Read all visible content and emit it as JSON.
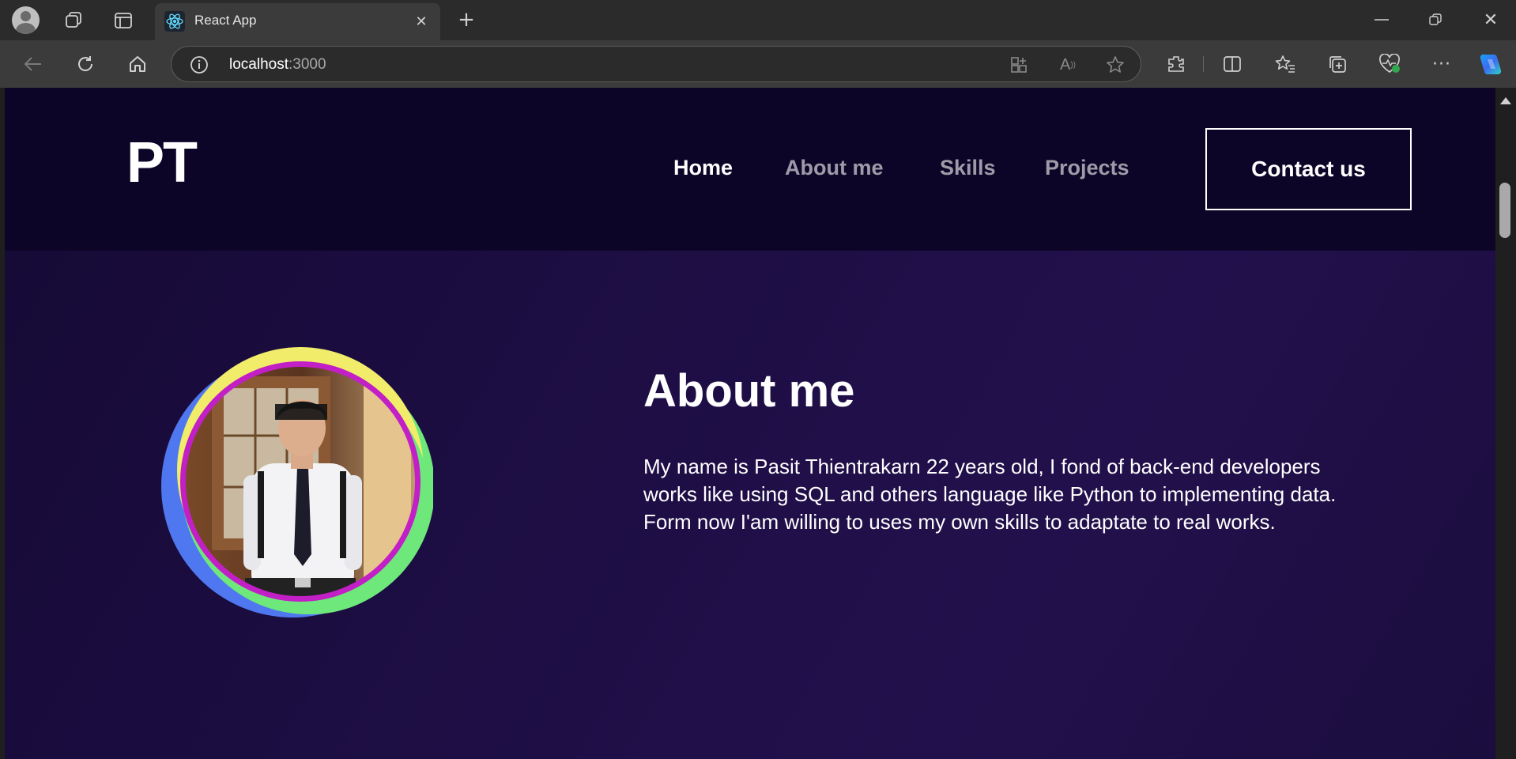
{
  "browser": {
    "tab_title": "React App",
    "address_host": "localhost",
    "address_port": ":3000"
  },
  "site": {
    "logo": "PT",
    "nav": [
      {
        "label": "Home",
        "active": true
      },
      {
        "label": "About me",
        "active": false
      },
      {
        "label": "Skills",
        "active": false
      },
      {
        "label": "Projects",
        "active": false
      }
    ],
    "contact_label": "Contact us"
  },
  "about": {
    "heading": "About me",
    "bio": "My name is Pasit Thientrakarn 22 years old, I fond of back-end developers works like using SQL and others language like Python to implementing data. Form now I'am willing to uses my own skills to adaptate to real works."
  },
  "colors": {
    "nav_bg": "#0d0527",
    "page_bg": "#1e0e45",
    "ring_yellow": "#f1ed6a",
    "ring_blue": "#4f78f0",
    "ring_green": "#6ee87a",
    "ring_magenta": "#c21fc6"
  },
  "icons": [
    "profile-icon",
    "workspaces-icon",
    "tab-actions-icon",
    "react-icon",
    "close-icon",
    "new-tab-icon",
    "back-icon",
    "refresh-icon",
    "home-icon",
    "info-icon",
    "apps-icon",
    "read-aloud-icon",
    "favorite-star-icon",
    "extensions-icon",
    "split-screen-icon",
    "favorites-icon",
    "collections-icon",
    "health-icon",
    "more-icon",
    "copilot-icon",
    "minimize-icon",
    "restore-icon",
    "window-close-icon"
  ]
}
